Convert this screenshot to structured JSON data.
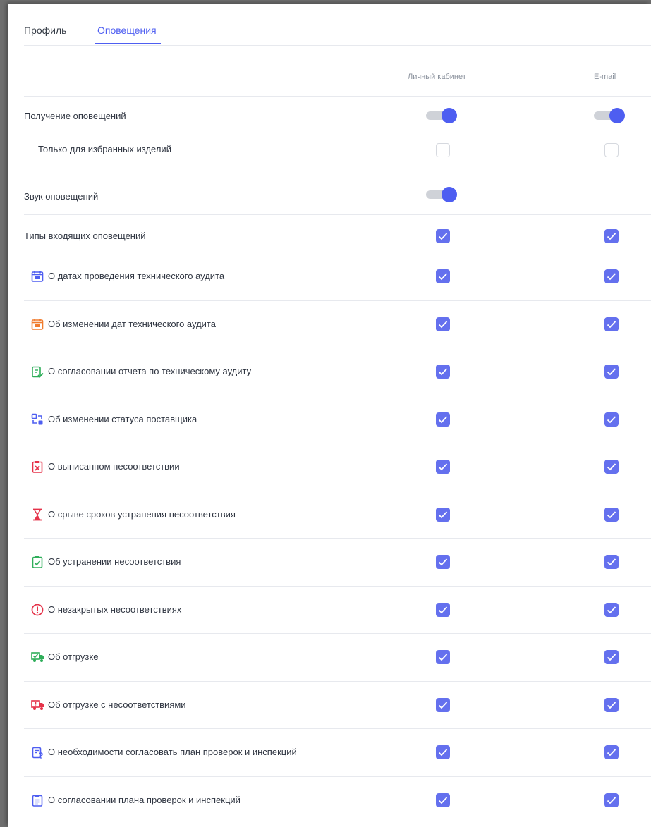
{
  "tabs": {
    "profile": "Профиль",
    "notifications": "Оповещения"
  },
  "columns": {
    "personal": "Личный кабинет",
    "email": "E-mail"
  },
  "settings": {
    "receive": "Получение оповещений",
    "favorites_only": "Только для избранных изделий",
    "sound": "Звук оповещений",
    "types": "Типы входящих оповещений"
  },
  "items": [
    {
      "label": "О датах проведения технического аудита",
      "icon": "calendar-icon",
      "color": "#4e5ef1"
    },
    {
      "label": "Об изменении дат технического аудита",
      "icon": "calendar-edit-icon",
      "color": "#f07c2e"
    },
    {
      "label": "О согласовании отчета по техническому аудиту",
      "icon": "report-approved-icon",
      "color": "#2fae5a"
    },
    {
      "label": "Об изменении статуса поставщика",
      "icon": "status-change-icon",
      "color": "#4e5ef1"
    },
    {
      "label": "О выписанном несоответствии",
      "icon": "clipboard-x-icon",
      "color": "#e5334a"
    },
    {
      "label": "О срыве сроков устранения несоответствия",
      "icon": "hourglass-icon",
      "color": "#e5334a"
    },
    {
      "label": "Об устранении несоответствия",
      "icon": "clipboard-check-icon",
      "color": "#2fae5a"
    },
    {
      "label": "О незакрытых несоответствиях",
      "icon": "alert-circle-icon",
      "color": "#e5334a"
    },
    {
      "label": "Об отгрузке",
      "icon": "truck-icon",
      "color": "#2fae5a"
    },
    {
      "label": "Об отгрузке с несоответствиями",
      "icon": "truck-warning-icon",
      "color": "#e5334a"
    },
    {
      "label": "О необходимости согласовать план проверок и инспекций",
      "icon": "document-question-icon",
      "color": "#4e5ef1"
    },
    {
      "label": "О согласовании плана проверок и инспекций",
      "icon": "clipboard-list-icon",
      "color": "#4e5ef1"
    }
  ],
  "colors": {
    "accent": "#4e5ef1",
    "checkbox": "#6470ee"
  }
}
